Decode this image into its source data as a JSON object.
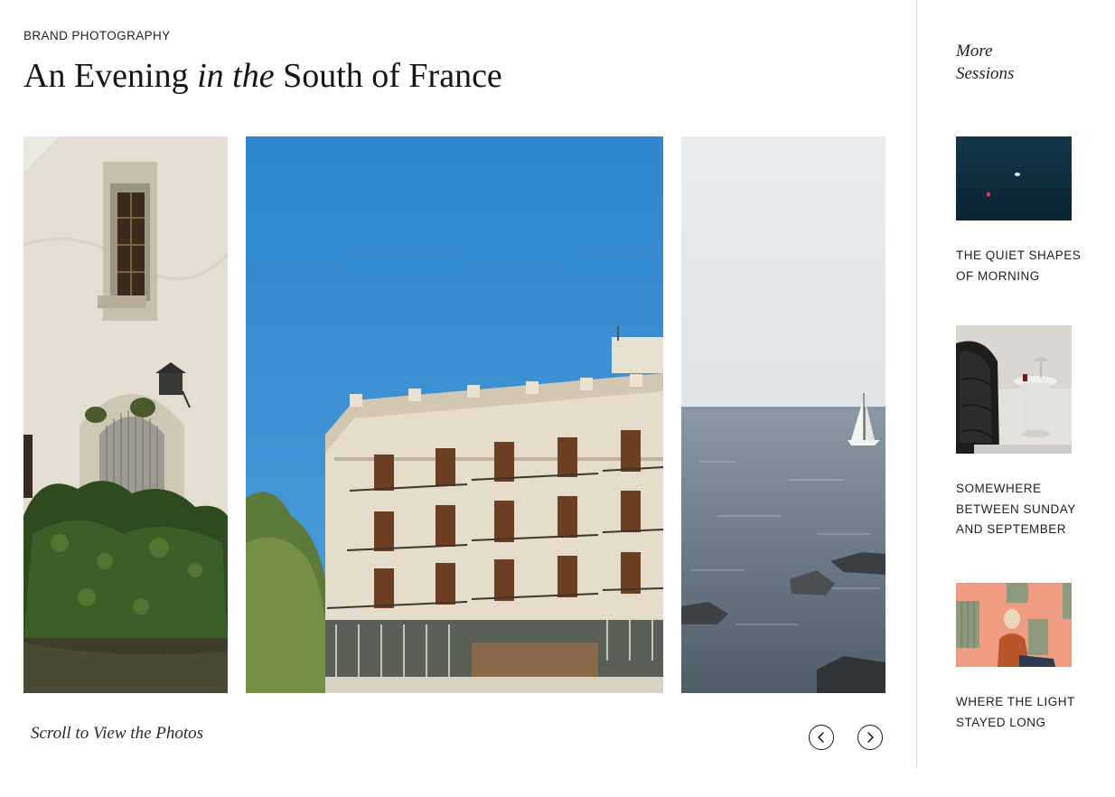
{
  "header": {
    "eyebrow": "BRAND PHOTOGRAPHY",
    "title_part1": "An Evening ",
    "title_italic": "in the",
    "title_part2": " South of France"
  },
  "gallery": {
    "photos": [
      {
        "subject": "weathered stone house with window and hedge"
      },
      {
        "subject": "ornate apartment building with balconies under blue sky"
      },
      {
        "subject": "calm sea with sailboat and rocky shore"
      }
    ],
    "scroll_hint": "Scroll to View the Photos",
    "prev_icon": "chevron-left-icon",
    "next_icon": "chevron-right-icon"
  },
  "sidebar": {
    "title_line1": "More",
    "title_line2": "Sessions",
    "sessions": [
      {
        "label_line1": "THE QUIET SHAPES",
        "label_line2": "OF MORNING",
        "label_line3": ""
      },
      {
        "label_line1": "SOMEWHERE",
        "label_line2": "BETWEEN SUNDAY",
        "label_line3": "AND SEPTEMBER"
      },
      {
        "label_line1": "WHERE THE LIGHT",
        "label_line2": "STAYED LONG",
        "label_line3": ""
      }
    ]
  },
  "colors": {
    "text": "#1a1a1a",
    "divider": "#d4d4d4",
    "sky": "#3a8fd0",
    "sea": "#5d6e79"
  }
}
